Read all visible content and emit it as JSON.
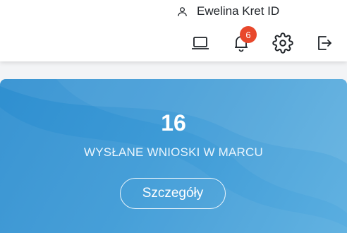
{
  "header": {
    "user_name": "Ewelina Kret ID",
    "notification_count": "6"
  },
  "card": {
    "count": "16",
    "label": "WYSŁANE WNIOSKI W MARCU",
    "details_button": "Szczegóły"
  }
}
